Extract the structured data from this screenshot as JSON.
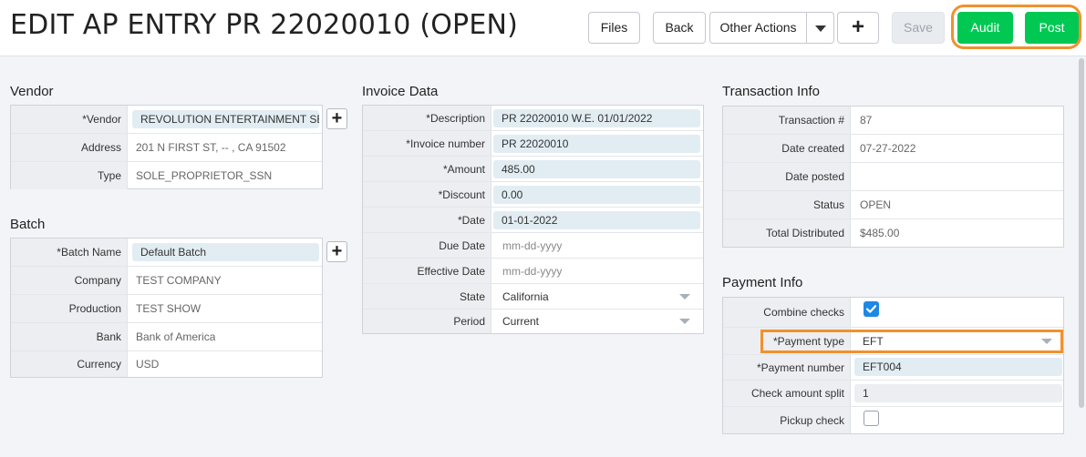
{
  "header": {
    "title": "EDIT AP ENTRY PR 22020010 (OPEN)",
    "buttons": {
      "files": "Files",
      "back": "Back",
      "other_actions": "Other Actions",
      "add": "+",
      "save": "Save",
      "audit": "Audit",
      "post": "Post"
    }
  },
  "colors": {
    "accent_green": "#00c853",
    "highlight_orange": "#f0912d",
    "checkbox_blue": "#1e88e5",
    "field_bg": "#e2edf3"
  },
  "vendor": {
    "title": "Vendor",
    "vendor_label": "*Vendor",
    "vendor_value": "REVOLUTION ENTERTAINMENT SERVICE",
    "address_label": "Address",
    "address_value": "201 N FIRST ST, -- , CA 91502",
    "type_label": "Type",
    "type_value": "SOLE_PROPRIETOR_SSN"
  },
  "batch": {
    "title": "Batch",
    "batch_name_label": "*Batch Name",
    "batch_name_value": "Default Batch",
    "company_label": "Company",
    "company_value": "TEST COMPANY",
    "production_label": "Production",
    "production_value": "TEST SHOW",
    "bank_label": "Bank",
    "bank_value": "Bank of America",
    "currency_label": "Currency",
    "currency_value": "USD"
  },
  "invoice": {
    "title": "Invoice Data",
    "description_label": "*Description",
    "description_value": "PR 22020010 W.E. 01/01/2022",
    "invoice_number_label": "*Invoice number",
    "invoice_number_value": "PR 22020010",
    "amount_label": "*Amount",
    "amount_value": "485.00",
    "discount_label": "*Discount",
    "discount_value": "0.00",
    "date_label": "*Date",
    "date_value": "01-01-2022",
    "due_date_label": "Due Date",
    "due_date_placeholder": "mm-dd-yyyy",
    "effective_date_label": "Effective Date",
    "effective_date_placeholder": "mm-dd-yyyy",
    "state_label": "State",
    "state_value": "California",
    "period_label": "Period",
    "period_value": "Current"
  },
  "transaction": {
    "title": "Transaction Info",
    "transaction_no_label": "Transaction #",
    "transaction_no_value": "87",
    "date_created_label": "Date created",
    "date_created_value": "07-27-2022",
    "date_posted_label": "Date posted",
    "date_posted_value": "",
    "status_label": "Status",
    "status_value": "OPEN",
    "total_distributed_label": "Total Distributed",
    "total_distributed_value": "$485.00"
  },
  "payment": {
    "title": "Payment Info",
    "combine_checks_label": "Combine checks",
    "combine_checks_checked": true,
    "payment_type_label": "*Payment type",
    "payment_type_value": "EFT",
    "payment_number_label": "*Payment number",
    "payment_number_value": "EFT004",
    "check_amount_split_label": "Check amount split",
    "check_amount_split_value": "1",
    "pickup_check_label": "Pickup check",
    "pickup_check_checked": false
  }
}
